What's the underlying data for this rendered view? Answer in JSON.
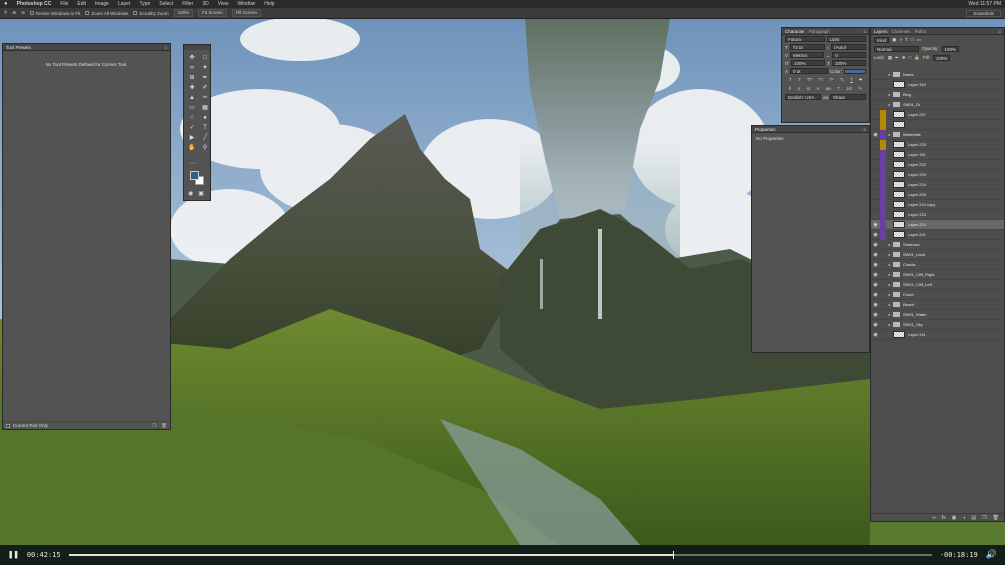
{
  "menubar": {
    "apple": "",
    "items": [
      "Photoshop CC",
      "File",
      "Edit",
      "Image",
      "Layer",
      "Type",
      "Select",
      "Filter",
      "3D",
      "View",
      "Window",
      "Help"
    ],
    "right": [
      "Wed 11:57 PM"
    ]
  },
  "optionsbar": {
    "resize_windows": "Resize Windows to Fit",
    "zoom_all": "Zoom All Windows",
    "scrubby": "Scrubby Zoom",
    "zoom_level": "100%",
    "fit_screen": "Fit Screen",
    "fill_screen": "Fill Screen",
    "workspace": "Essentials"
  },
  "tool_presets": {
    "title": "Tool Presets",
    "empty_message": "No Tool Presets Defined for Current Tool.",
    "current_tool_only": "Current Tool Only"
  },
  "character": {
    "tab_character": "Character",
    "tab_paragraph": "Paragraph",
    "font_family": "Futura",
    "font_style": "Light",
    "size": "72 pt",
    "leading": "(Auto)",
    "kerning": "Metrics",
    "tracking": "0",
    "scale_v": "100%",
    "scale_h": "100%",
    "baseline": "0 pt",
    "color_label": "Color:",
    "language": "English: USA",
    "antialias": "Sharp",
    "color": "#4a6a9a"
  },
  "properties": {
    "title": "Properties",
    "message": "No Properties"
  },
  "layers": {
    "tabs": [
      "Layers",
      "Channels",
      "Paths"
    ],
    "kind": "Kind",
    "blend": "Normal",
    "opacity_label": "Opacity:",
    "opacity": "100%",
    "lock_label": "Lock:",
    "fill_label": "Fill:",
    "fill": "100%",
    "items": [
      {
        "name": "Notes",
        "type": "folder",
        "visible": false,
        "tag": ""
      },
      {
        "name": "Layer 340",
        "type": "layer",
        "visible": false,
        "tag": ""
      },
      {
        "name": "Bing",
        "type": "folder",
        "visible": false,
        "tag": ""
      },
      {
        "name": "SW01_DI",
        "type": "folder",
        "visible": false,
        "tag": ""
      },
      {
        "name": "Layer 237",
        "type": "layer",
        "visible": false,
        "tag": "#b48a00"
      },
      {
        "name": "",
        "type": "layer",
        "visible": false,
        "tag": "#b48a00"
      },
      {
        "name": "Waterfalls",
        "type": "folder",
        "visible": true,
        "tag": "#6a3fa0"
      },
      {
        "name": "Layer 233",
        "type": "layer",
        "visible": false,
        "tag": "#b48a00"
      },
      {
        "name": "Layer 181",
        "type": "layer",
        "visible": false,
        "tag": "#6a3fa0"
      },
      {
        "name": "Layer 232",
        "type": "layer",
        "visible": false,
        "tag": "#6a3fa0"
      },
      {
        "name": "Layer 229",
        "type": "layer",
        "visible": false,
        "tag": "#6a3fa0"
      },
      {
        "name": "Layer 224",
        "type": "layer",
        "visible": false,
        "tag": "#6a3fa0"
      },
      {
        "name": "Layer 226",
        "type": "layer",
        "visible": false,
        "tag": "#6a3fa0"
      },
      {
        "name": "Layer 224 copy",
        "type": "layer",
        "visible": false,
        "tag": "#6a3fa0"
      },
      {
        "name": "Layer 223",
        "type": "layer",
        "visible": false,
        "tag": "#6a3fa0"
      },
      {
        "name": "Layer 222",
        "type": "layer",
        "visible": true,
        "tag": "#6a3fa0",
        "selected": true
      },
      {
        "name": "Layer 221",
        "type": "layer",
        "visible": true,
        "tag": "#6a3fa0"
      },
      {
        "name": "Shadows",
        "type": "folder",
        "visible": true,
        "tag": ""
      },
      {
        "name": "SW01_Land",
        "type": "folder",
        "visible": true,
        "tag": ""
      },
      {
        "name": "Clouds",
        "type": "folder",
        "visible": true,
        "tag": ""
      },
      {
        "name": "SW01_Cliff_Right",
        "type": "folder",
        "visible": true,
        "tag": ""
      },
      {
        "name": "SW01_Cliff_Left",
        "type": "folder",
        "visible": true,
        "tag": ""
      },
      {
        "name": "Cloud",
        "type": "folder",
        "visible": true,
        "tag": ""
      },
      {
        "name": "Beach",
        "type": "folder",
        "visible": true,
        "tag": ""
      },
      {
        "name": "SW01_Water",
        "type": "folder",
        "visible": true,
        "tag": ""
      },
      {
        "name": "SW01_Sky",
        "type": "folder",
        "visible": true,
        "tag": ""
      },
      {
        "name": "Layer 241",
        "type": "layer",
        "visible": true,
        "tag": ""
      }
    ]
  },
  "video": {
    "elapsed": "00:42:15",
    "remaining": "-00:18:19",
    "progress": 0.7
  }
}
